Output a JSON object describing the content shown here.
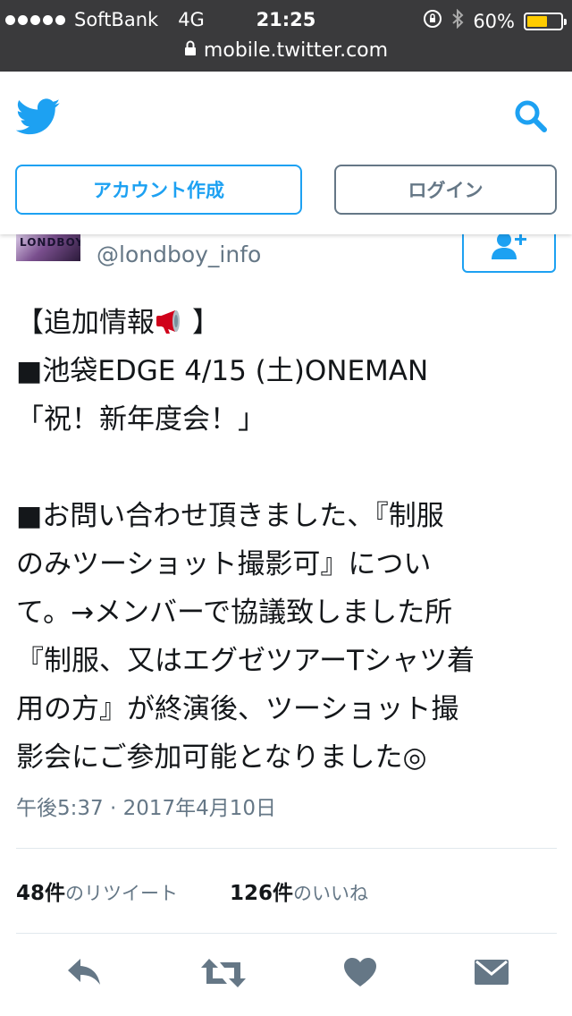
{
  "status_bar": {
    "carrier": "SoftBank",
    "network": "4G",
    "time": "21:25",
    "battery": "60%",
    "battery_level": 0.6,
    "battery_color": "#ffcc00"
  },
  "url_bar": {
    "url": "mobile.twitter.com"
  },
  "header": {
    "signup_label": "アカウント作成",
    "login_label": "ログイン",
    "accent_color": "#1da1f2"
  },
  "tweet": {
    "avatar_text": "LONDBOY",
    "handle": "@londboy_info",
    "lines": [
      "【追加情報",
      "】",
      "■池袋EDGE 4/15 (土)ONEMAN",
      "「祝！新年度会！」",
      "",
      "■お問い合わせ頂きました、『制服",
      "のみツーショット撮影可』につい",
      "て。→メンバーで協議致しました所",
      "『制服、又はエグゼツアーTシャツ着",
      "用の方』が終演後、ツーショット撮",
      "影会にご参加可能となりました◎"
    ],
    "timestamp": "午後5:37 · 2017年4月10日"
  },
  "stats": {
    "retweets_count": "48件",
    "retweets_label": "のリツイート",
    "likes_count": "126件",
    "likes_label": "のいいね"
  },
  "icons": [
    "twitter-bird-icon",
    "search-icon",
    "follow-user-icon",
    "megaphone-icon",
    "reply-icon",
    "retweet-icon",
    "like-icon",
    "message-icon",
    "lock-icon",
    "bluetooth-icon",
    "rotation-lock-icon"
  ]
}
